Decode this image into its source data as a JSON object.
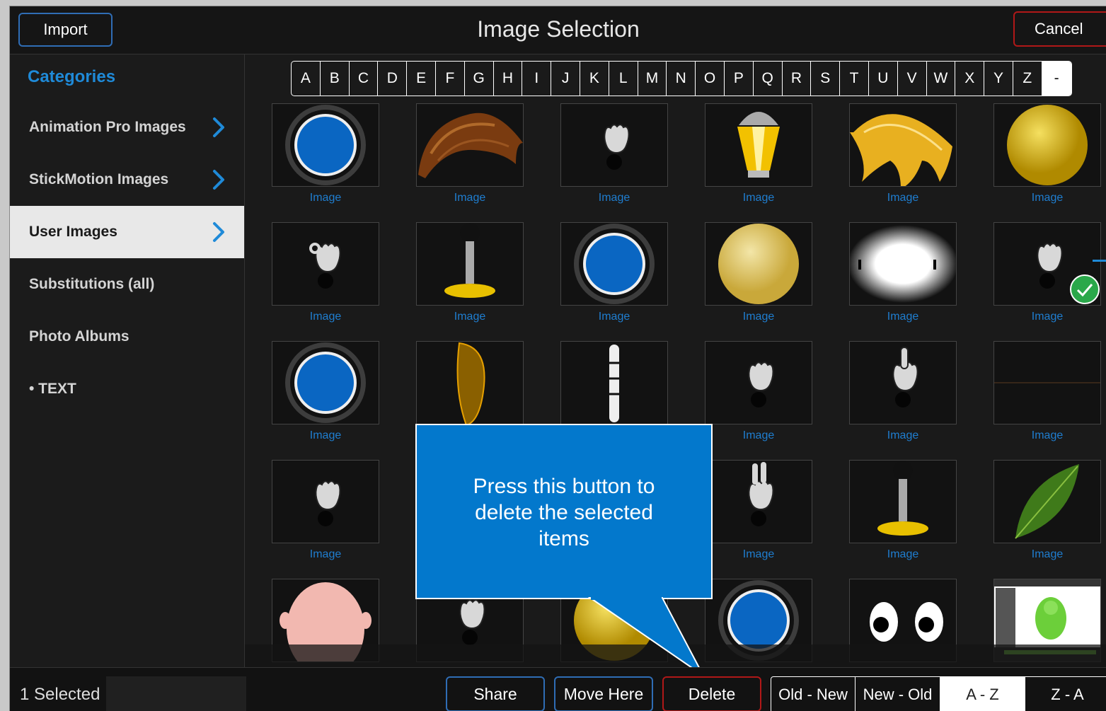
{
  "header": {
    "import_label": "Import",
    "title": "Image Selection",
    "cancel_label": "Cancel"
  },
  "sidebar": {
    "title": "Categories",
    "items": [
      {
        "label": "Animation Pro Images",
        "has_chevron": true,
        "selected": false
      },
      {
        "label": "StickMotion Images",
        "has_chevron": true,
        "selected": false
      },
      {
        "label": "User Images",
        "has_chevron": true,
        "selected": true
      },
      {
        "label": "Substitutions (all)",
        "has_chevron": false,
        "selected": false
      },
      {
        "label": "Photo Albums",
        "has_chevron": false,
        "selected": false
      },
      {
        "label": "• TEXT",
        "has_chevron": false,
        "selected": false
      }
    ]
  },
  "alphabet": [
    "A",
    "B",
    "C",
    "D",
    "E",
    "F",
    "G",
    "H",
    "I",
    "J",
    "K",
    "L",
    "M",
    "N",
    "O",
    "P",
    "Q",
    "R",
    "S",
    "T",
    "U",
    "V",
    "W",
    "X",
    "Y",
    "Z",
    "-"
  ],
  "images": [
    {
      "icon": "blue-circle-icon",
      "label": "Image"
    },
    {
      "icon": "brown-hair-icon",
      "label": "Image"
    },
    {
      "icon": "hand-fist-icon",
      "label": "Image"
    },
    {
      "icon": "yellow-bulb-icon",
      "label": "Image"
    },
    {
      "icon": "blonde-hair-icon",
      "label": "Image"
    },
    {
      "icon": "yellow-ball-icon",
      "label": "Image"
    },
    {
      "icon": "hand-ok-icon",
      "label": "Image"
    },
    {
      "icon": "joystick-icon",
      "label": "Image"
    },
    {
      "icon": "blue-circle-icon",
      "label": "Image"
    },
    {
      "icon": "pale-ball-icon",
      "label": "Image"
    },
    {
      "icon": "glow-eyes-icon",
      "label": "Image"
    },
    {
      "icon": "hand-open-icon",
      "label": "Image",
      "checked": true
    },
    {
      "icon": "blue-circle-icon",
      "label": "Image"
    },
    {
      "icon": "orange-lens-icon",
      "label": ""
    },
    {
      "icon": "segmented-bar-icon",
      "label": ""
    },
    {
      "icon": "hand-rock-icon",
      "label": "Image"
    },
    {
      "icon": "hand-point-icon",
      "label": "Image"
    },
    {
      "icon": "blank-icon",
      "label": "Image"
    },
    {
      "icon": "hand-fist-icon",
      "label": "Image"
    },
    {
      "icon": "hidden-icon",
      "label": ""
    },
    {
      "icon": "hidden-icon",
      "label": ""
    },
    {
      "icon": "hand-flat-icon",
      "label": "Image"
    },
    {
      "icon": "joystick-icon",
      "label": "Image"
    },
    {
      "icon": "leaf-icon",
      "label": "Image"
    },
    {
      "icon": "head-icon",
      "label": ""
    },
    {
      "icon": "hand-side-icon",
      "label": ""
    },
    {
      "icon": "yellow-ball-icon",
      "label": ""
    },
    {
      "icon": "blue-circle-icon",
      "label": ""
    },
    {
      "icon": "eyes-icon",
      "label": ""
    },
    {
      "icon": "app-screenshot-icon",
      "label": ""
    }
  ],
  "callout": {
    "text": "Press this button to delete the selected items"
  },
  "footer": {
    "selected_text": "1 Selected",
    "share_label": "Share",
    "move_label": "Move Here",
    "delete_label": "Delete",
    "sort_options": [
      "Old - New",
      "New - Old",
      "A - Z",
      "Z - A"
    ],
    "sort_active": "A - Z"
  },
  "colors": {
    "accent": "#1f8ad8",
    "danger": "#b01818",
    "callout": "#0378cc"
  }
}
